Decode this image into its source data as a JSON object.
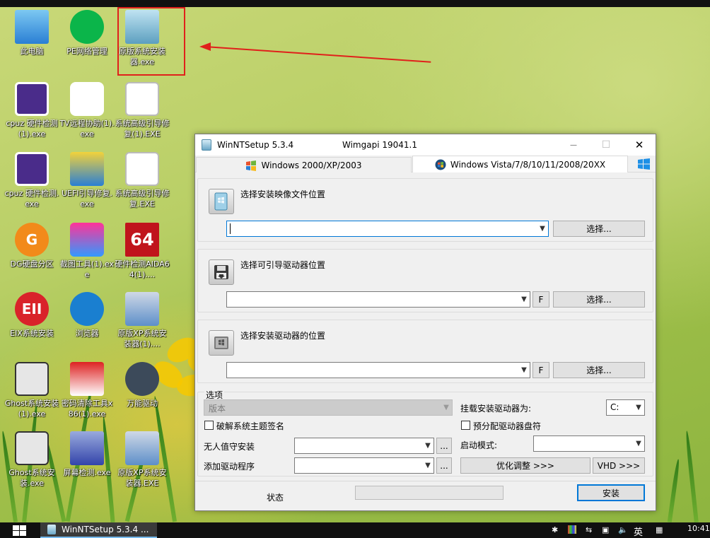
{
  "desktop": {
    "icons": [
      {
        "label": "此电脑"
      },
      {
        "label": "PE网络管理"
      },
      {
        "label": "原版系统安装器.exe"
      },
      {
        "label": "cpuz 硬件检测(1).exe"
      },
      {
        "label": "TV远程协助(1).exe"
      },
      {
        "label": "系统高级引导修复(1).EXE"
      },
      {
        "label": "cpuz 硬件检测.exe"
      },
      {
        "label": "UEFI引导修复.exe"
      },
      {
        "label": "系统高级引导修复.EXE"
      },
      {
        "label": "DG硬盘分区"
      },
      {
        "label": "截图工具(1).exe"
      },
      {
        "label": "硬件检测AIDA64(1)...."
      },
      {
        "label": "EIX系统安装"
      },
      {
        "label": "浏览器"
      },
      {
        "label": "原版XP系统安装器(1)...."
      },
      {
        "label": "Ghost系统安装(1).exe"
      },
      {
        "label": "密码清除工具x86(1).exe"
      },
      {
        "label": "万能驱动"
      },
      {
        "label": "Ghost系统安装.exe"
      },
      {
        "label": "屏幕检测.exe"
      },
      {
        "label": "原版XP系统安装器.EXE"
      }
    ],
    "aida_badge": "64",
    "dg_badge": "G",
    "eix_badge": "EII"
  },
  "window": {
    "title": "WinNTSetup 5.3.4",
    "wimgapi": "Wimgapi 19041.1",
    "close_glyph": "✕",
    "max_glyph": "☐",
    "min_glyph": "—",
    "tabs": [
      {
        "label": "Windows 2000/XP/2003"
      },
      {
        "label": "Windows Vista/7/8/10/11/2008/20XX"
      }
    ],
    "sections": {
      "image": {
        "title": "选择安装映像文件位置",
        "value": "",
        "browse": "选择..."
      },
      "boot": {
        "title": "选择可引导驱动器位置",
        "value": "",
        "f": "F",
        "browse": "选择..."
      },
      "install": {
        "title": "选择安装驱动器的位置",
        "value": "",
        "f": "F",
        "browse": "选择..."
      }
    },
    "options": {
      "label": "选项",
      "edition": "版本",
      "mount_label": "挂载安装驱动器为:",
      "mount_value": "C:",
      "patch_theme": "破解系统主题签名",
      "prealloc": "预分配驱动器盘符",
      "unattended": "无人值守安装",
      "unattended_value": "",
      "ellipsis": "...",
      "boot_mode": "启动模式:",
      "boot_mode_value": "",
      "add_drivers": "添加驱动程序",
      "add_drivers_value": "",
      "tweaks": "优化调整 >>>",
      "vhd": "VHD >>>"
    },
    "status_label": "状态",
    "install_button": "安装"
  },
  "taskbar": {
    "item": "WinNTSetup 5.3.4 ...",
    "ime": "英",
    "time": "10:41"
  }
}
